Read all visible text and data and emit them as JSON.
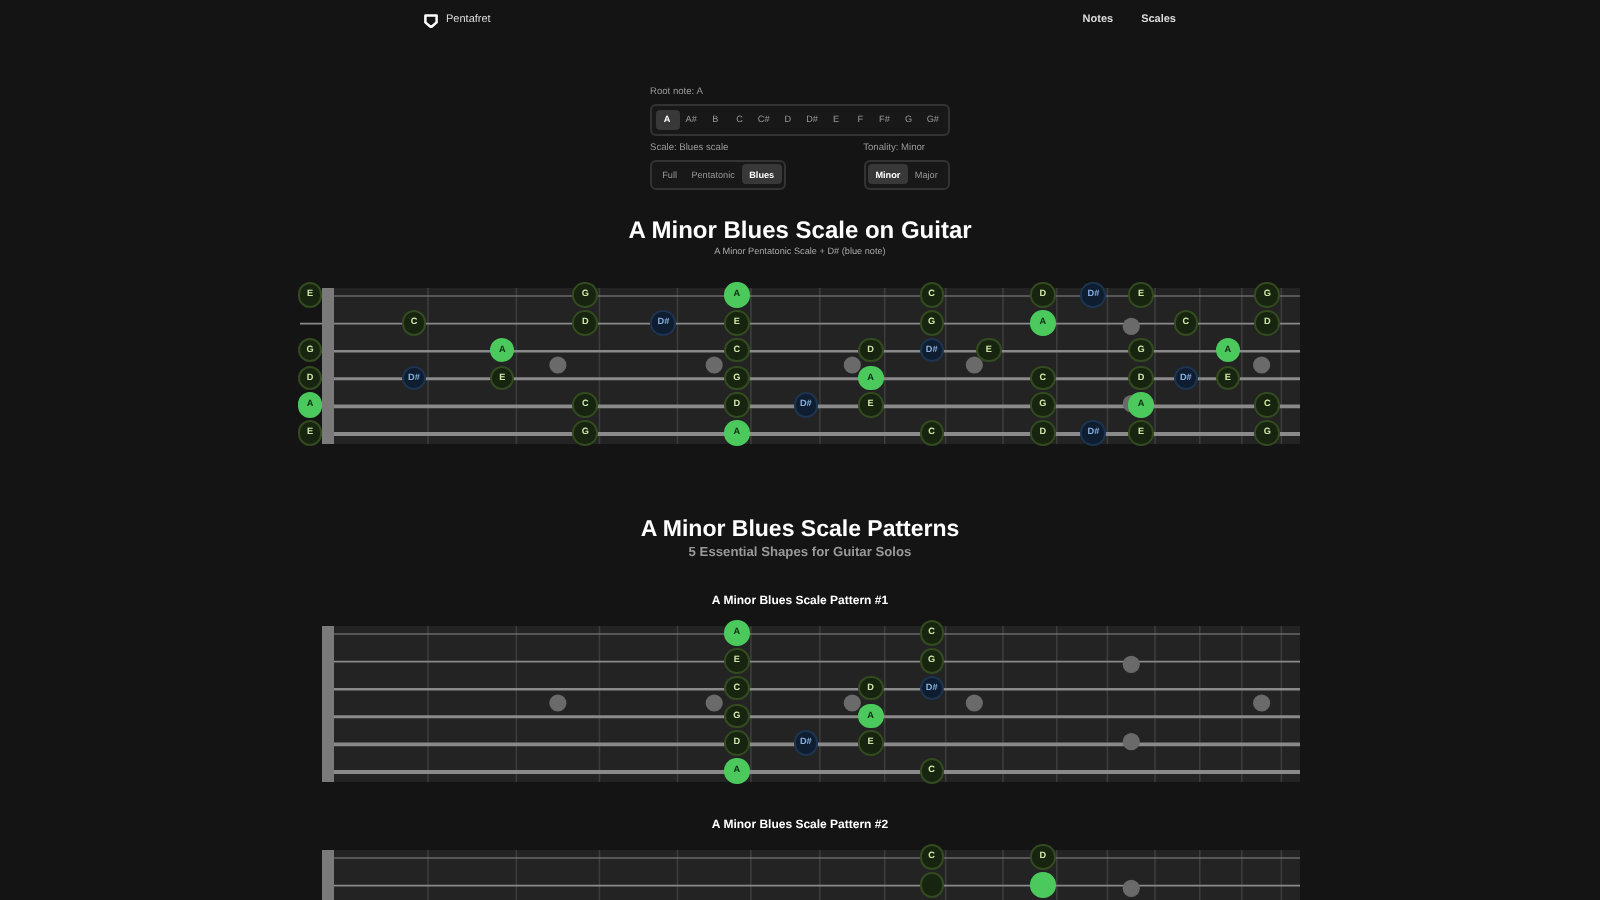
{
  "header": {
    "brand": "Pentafret",
    "nav": [
      {
        "label": "Notes"
      },
      {
        "label": "Scales"
      }
    ]
  },
  "root_note": {
    "label": "Root note: A",
    "options": [
      {
        "label": "A",
        "selected": true
      },
      {
        "label": "A#",
        "selected": false
      },
      {
        "label": "B",
        "selected": false
      },
      {
        "label": "C",
        "selected": false
      },
      {
        "label": "C#",
        "selected": false
      },
      {
        "label": "D",
        "selected": false
      },
      {
        "label": "D#",
        "selected": false
      },
      {
        "label": "E",
        "selected": false
      },
      {
        "label": "F",
        "selected": false
      },
      {
        "label": "F#",
        "selected": false
      },
      {
        "label": "G",
        "selected": false
      },
      {
        "label": "G#",
        "selected": false
      }
    ]
  },
  "scale": {
    "label": "Scale: Blues scale",
    "options": [
      {
        "label": "Full",
        "selected": false
      },
      {
        "label": "Pentatonic",
        "selected": false
      },
      {
        "label": "Blues",
        "selected": true
      }
    ]
  },
  "tonality": {
    "label": "Tonality: Minor",
    "options": [
      {
        "label": "Minor",
        "selected": true
      },
      {
        "label": "Major",
        "selected": false
      }
    ]
  },
  "main": {
    "title": "A Minor Blues Scale on Guitar",
    "subtitle": "A Minor Pentatonic Scale + D# (blue note)",
    "fretboard": {
      "strings": [
        {
          "frets": [
            {
              "note": "E",
              "kind": "tone"
            },
            {
              "kind": "none"
            },
            {
              "kind": "none"
            },
            {
              "note": "G",
              "kind": "tone"
            },
            {
              "kind": "none"
            },
            {
              "note": "A",
              "kind": "root"
            },
            {
              "kind": "none"
            },
            {
              "kind": "none"
            },
            {
              "note": "C",
              "kind": "tone"
            },
            {
              "kind": "none"
            },
            {
              "note": "D",
              "kind": "tone"
            },
            {
              "note": "D#",
              "kind": "blue"
            },
            {
              "note": "E",
              "kind": "tone"
            },
            {
              "kind": "none"
            },
            {
              "kind": "none"
            },
            {
              "note": "G",
              "kind": "tone"
            }
          ]
        },
        {
          "frets": [
            {
              "kind": "none"
            },
            {
              "note": "C",
              "kind": "tone"
            },
            {
              "kind": "none"
            },
            {
              "note": "D",
              "kind": "tone"
            },
            {
              "note": "D#",
              "kind": "blue"
            },
            {
              "note": "E",
              "kind": "tone"
            },
            {
              "kind": "none"
            },
            {
              "kind": "none"
            },
            {
              "note": "G",
              "kind": "tone"
            },
            {
              "kind": "none"
            },
            {
              "note": "A",
              "kind": "root"
            },
            {
              "kind": "none"
            },
            {
              "kind": "none"
            },
            {
              "note": "C",
              "kind": "tone"
            },
            {
              "kind": "none"
            },
            {
              "note": "D",
              "kind": "tone"
            }
          ]
        },
        {
          "frets": [
            {
              "note": "G",
              "kind": "tone"
            },
            {
              "kind": "none"
            },
            {
              "note": "A",
              "kind": "root"
            },
            {
              "kind": "none"
            },
            {
              "kind": "none"
            },
            {
              "note": "C",
              "kind": "tone"
            },
            {
              "kind": "none"
            },
            {
              "note": "D",
              "kind": "tone"
            },
            {
              "note": "D#",
              "kind": "blue"
            },
            {
              "note": "E",
              "kind": "tone"
            },
            {
              "kind": "none"
            },
            {
              "kind": "none"
            },
            {
              "note": "G",
              "kind": "tone"
            },
            {
              "kind": "none"
            },
            {
              "note": "A",
              "kind": "root"
            }
          ]
        },
        {
          "frets": [
            {
              "note": "D",
              "kind": "tone"
            },
            {
              "note": "D#",
              "kind": "blue"
            },
            {
              "note": "E",
              "kind": "tone"
            },
            {
              "kind": "none"
            },
            {
              "kind": "none"
            },
            {
              "note": "G",
              "kind": "tone"
            },
            {
              "kind": "none"
            },
            {
              "note": "A",
              "kind": "root"
            },
            {
              "kind": "none"
            },
            {
              "kind": "none"
            },
            {
              "note": "C",
              "kind": "tone"
            },
            {
              "kind": "none"
            },
            {
              "note": "D",
              "kind": "tone"
            },
            {
              "note": "D#",
              "kind": "blue"
            },
            {
              "note": "E",
              "kind": "tone"
            }
          ]
        },
        {
          "frets": [
            {
              "note": "A",
              "kind": "root"
            },
            {
              "kind": "none"
            },
            {
              "kind": "none"
            },
            {
              "note": "C",
              "kind": "tone"
            },
            {
              "kind": "none"
            },
            {
              "note": "D",
              "kind": "tone"
            },
            {
              "note": "D#",
              "kind": "blue"
            },
            {
              "note": "E",
              "kind": "tone"
            },
            {
              "kind": "none"
            },
            {
              "kind": "none"
            },
            {
              "note": "G",
              "kind": "tone"
            },
            {
              "kind": "none"
            },
            {
              "note": "A",
              "kind": "root"
            },
            {
              "kind": "none"
            },
            {
              "kind": "none"
            },
            {
              "note": "C",
              "kind": "tone"
            }
          ]
        },
        {
          "frets": [
            {
              "note": "E",
              "kind": "tone"
            },
            {
              "kind": "none"
            },
            {
              "kind": "none"
            },
            {
              "note": "G",
              "kind": "tone"
            },
            {
              "kind": "none"
            },
            {
              "note": "A",
              "kind": "root"
            },
            {
              "kind": "none"
            },
            {
              "kind": "none"
            },
            {
              "note": "C",
              "kind": "tone"
            },
            {
              "kind": "none"
            },
            {
              "note": "D",
              "kind": "tone"
            },
            {
              "note": "D#",
              "kind": "blue"
            },
            {
              "note": "E",
              "kind": "tone"
            },
            {
              "kind": "none"
            },
            {
              "kind": "none"
            },
            {
              "note": "G",
              "kind": "tone"
            }
          ]
        }
      ]
    }
  },
  "patterns": {
    "title": "A Minor Blues Scale Patterns",
    "subtitle": "5 Essential Shapes for Guitar Solos",
    "items": [
      {
        "title": "A Minor Blues Scale Pattern #1",
        "fretboard": {
          "strings": [
            {
              "frets": [
                {
                  "kind": "none"
                },
                {
                  "kind": "none"
                },
                {
                  "kind": "none"
                },
                {
                  "kind": "none"
                },
                {
                  "kind": "none"
                },
                {
                  "note": "A",
                  "kind": "root"
                },
                {
                  "kind": "none"
                },
                {
                  "kind": "none"
                },
                {
                  "note": "C",
                  "kind": "tone"
                }
              ]
            },
            {
              "frets": [
                {
                  "kind": "none"
                },
                {
                  "kind": "none"
                },
                {
                  "kind": "none"
                },
                {
                  "kind": "none"
                },
                {
                  "kind": "none"
                },
                {
                  "note": "E",
                  "kind": "tone"
                },
                {
                  "kind": "none"
                },
                {
                  "kind": "none"
                },
                {
                  "note": "G",
                  "kind": "tone"
                }
              ]
            },
            {
              "frets": [
                {
                  "kind": "none"
                },
                {
                  "kind": "none"
                },
                {
                  "kind": "none"
                },
                {
                  "kind": "none"
                },
                {
                  "kind": "none"
                },
                {
                  "note": "C",
                  "kind": "tone"
                },
                {
                  "kind": "none"
                },
                {
                  "note": "D",
                  "kind": "tone"
                },
                {
                  "note": "D#",
                  "kind": "blue"
                }
              ]
            },
            {
              "frets": [
                {
                  "kind": "none"
                },
                {
                  "kind": "none"
                },
                {
                  "kind": "none"
                },
                {
                  "kind": "none"
                },
                {
                  "kind": "none"
                },
                {
                  "note": "G",
                  "kind": "tone"
                },
                {
                  "kind": "none"
                },
                {
                  "note": "A",
                  "kind": "root"
                }
              ]
            },
            {
              "frets": [
                {
                  "kind": "none"
                },
                {
                  "kind": "none"
                },
                {
                  "kind": "none"
                },
                {
                  "kind": "none"
                },
                {
                  "kind": "none"
                },
                {
                  "note": "D",
                  "kind": "tone"
                },
                {
                  "note": "D#",
                  "kind": "blue"
                },
                {
                  "note": "E",
                  "kind": "tone"
                }
              ]
            },
            {
              "frets": [
                {
                  "kind": "none"
                },
                {
                  "kind": "none"
                },
                {
                  "kind": "none"
                },
                {
                  "kind": "none"
                },
                {
                  "kind": "none"
                },
                {
                  "note": "A",
                  "kind": "root"
                },
                {
                  "kind": "none"
                },
                {
                  "kind": "none"
                },
                {
                  "note": "C",
                  "kind": "tone"
                }
              ]
            }
          ]
        }
      },
      {
        "title": "A Minor Blues Scale Pattern #2",
        "fretboard": {
          "strings": [
            {
              "frets": [
                {
                  "kind": "none"
                },
                {
                  "kind": "none"
                },
                {
                  "kind": "none"
                },
                {
                  "kind": "none"
                },
                {
                  "kind": "none"
                },
                {
                  "kind": "none"
                },
                {
                  "kind": "none"
                },
                {
                  "kind": "none"
                },
                {
                  "note": "C",
                  "kind": "tone"
                },
                {
                  "kind": "none"
                },
                {
                  "note": "D",
                  "kind": "tone"
                }
              ]
            },
            {
              "frets": [
                {
                  "kind": "none"
                },
                {
                  "kind": "none"
                },
                {
                  "kind": "none"
                },
                {
                  "kind": "none"
                },
                {
                  "kind": "none"
                },
                {
                  "kind": "none"
                },
                {
                  "kind": "none"
                },
                {
                  "kind": "none"
                },
                {
                  "kind": "tone"
                },
                {
                  "kind": "none"
                },
                {
                  "kind": "root"
                }
              ]
            }
          ]
        }
      }
    ]
  }
}
